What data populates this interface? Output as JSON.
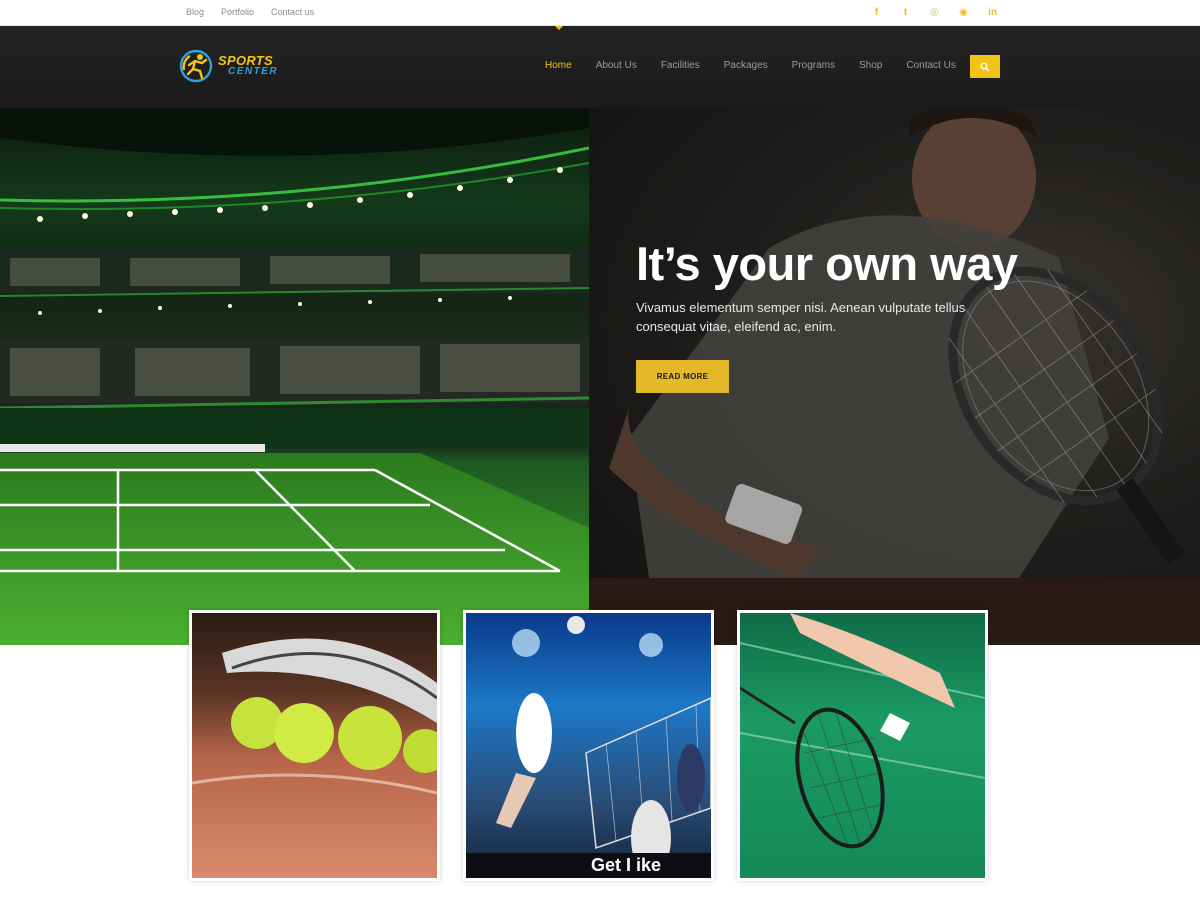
{
  "topbar": {
    "links": [
      "Blog",
      "Portfolio",
      "Contact us"
    ],
    "social_icons": [
      "facebook-icon",
      "twitter-icon",
      "dribbble-icon",
      "pinterest-icon",
      "linkedin-icon"
    ],
    "social_glyphs": [
      "f",
      "t",
      "◎",
      "◉",
      "in"
    ]
  },
  "brand": {
    "line1": "SPORTS",
    "line2": "CENTER"
  },
  "nav": {
    "items": [
      "Home",
      "About Us",
      "Facilities",
      "Packages",
      "Programs",
      "Shop",
      "Contact Us"
    ],
    "active": "Home"
  },
  "hero": {
    "title": "It’s your own way",
    "subtitle": "Vivamus elementum semper nisi. Aenean vulputate tellus consequat vitae, eleifend ac, enim.",
    "button": "READ MORE"
  },
  "cards": [
    {
      "name": "tennis-balls-card"
    },
    {
      "name": "volleyball-card",
      "overlay_text": "Get I ike"
    },
    {
      "name": "badminton-card"
    }
  ],
  "colors": {
    "accent": "#f2c318",
    "brand_blue": "#2fa2d8",
    "header_bg": "#1f1f1f"
  }
}
